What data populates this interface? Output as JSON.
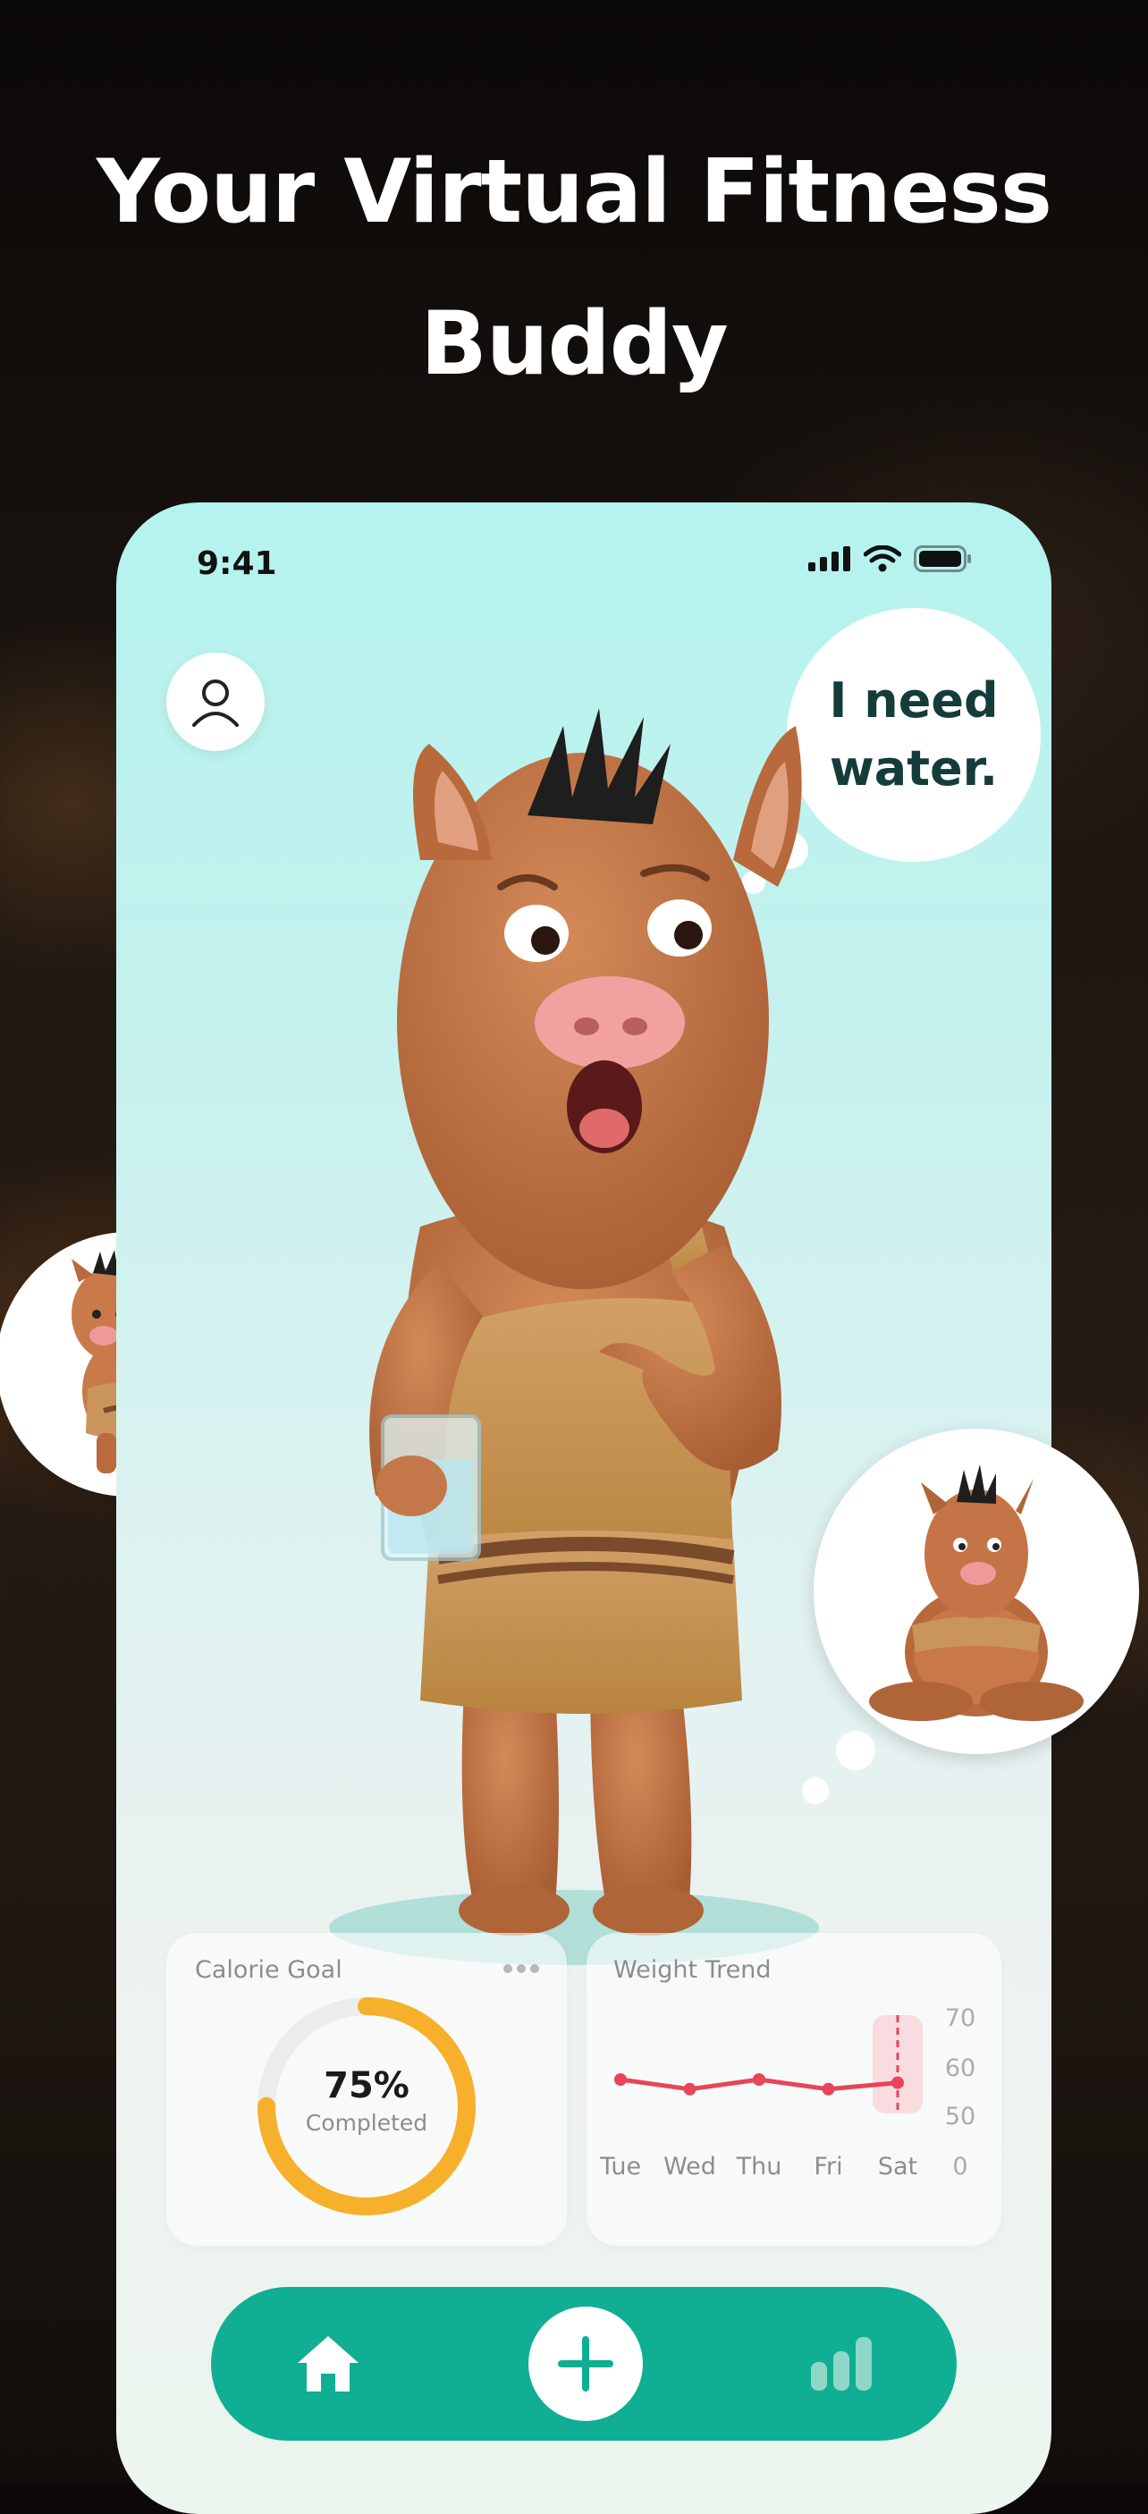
{
  "headline": {
    "line1": "Your Virtual Fitness",
    "line2": "Buddy"
  },
  "status_bar": {
    "time": "9:41",
    "icons": [
      "signal-icon",
      "wifi-icon",
      "battery-icon"
    ]
  },
  "speech_bubble": {
    "line1": "I need",
    "line2": "water."
  },
  "calorie_card": {
    "title": "Calorie Goal",
    "menu_icon": "more-dots-icon",
    "percent": "75%",
    "label": "Completed",
    "progress": 0.75,
    "ring_color": "#f7b02b",
    "track_color": "#ececec"
  },
  "chart_data": {
    "type": "line",
    "title": "Weight Trend",
    "categories": [
      "Tue",
      "Wed",
      "Thu",
      "Fri",
      "Sat"
    ],
    "series": [
      {
        "values": [
          60,
          57,
          60,
          57,
          59
        ]
      }
    ],
    "y_ticks": [
      "70",
      "60",
      "50",
      "0"
    ],
    "highlight_category": "Sat",
    "line_color": "#e8445a"
  },
  "bottom_nav": {
    "items": [
      "home-icon",
      "add-icon",
      "stats-icon"
    ],
    "accent": "#10ae93"
  },
  "colors": {
    "title_text": "#ffffff",
    "accent_teal": "#10ae93"
  }
}
